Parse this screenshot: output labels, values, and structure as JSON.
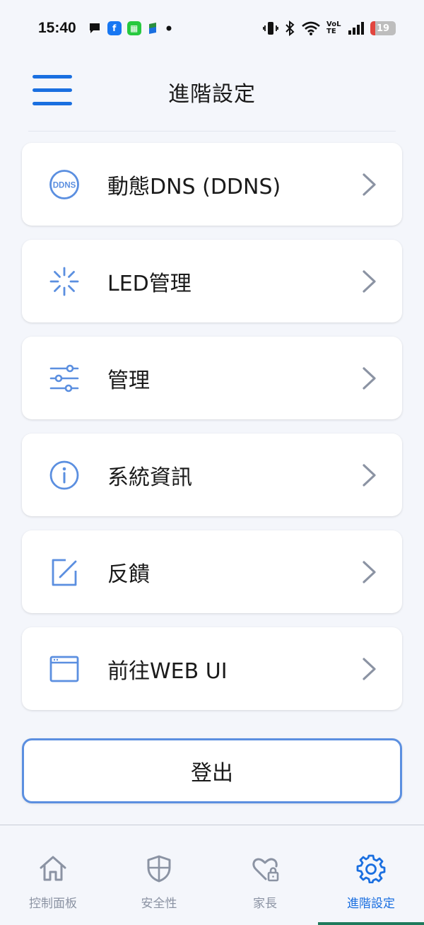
{
  "status_bar": {
    "time": "15:40",
    "battery_level": "19",
    "battery_fraction": 0.19,
    "network": "VoLTE",
    "icons": [
      "chat-icon",
      "facebook-icon",
      "app-icon",
      "app-icon",
      "dot-icon",
      "vibrate-icon",
      "bluetooth-icon",
      "wifi-icon",
      "signal-icon"
    ]
  },
  "header": {
    "title": "進階設定"
  },
  "menu": {
    "items": [
      {
        "label": "動態DNS (DDNS)",
        "icon": "ddns-icon",
        "icon_text": "DDNS"
      },
      {
        "label": "LED管理",
        "icon": "led-icon"
      },
      {
        "label": "管理",
        "icon": "sliders-icon"
      },
      {
        "label": "系統資訊",
        "icon": "info-icon"
      },
      {
        "label": "反饋",
        "icon": "edit-icon"
      },
      {
        "label": "前往WEB UI",
        "icon": "browser-window-icon"
      }
    ]
  },
  "logout": {
    "label": "登出"
  },
  "bottom_nav": {
    "items": [
      {
        "label": "控制面板",
        "icon": "home-icon",
        "active": false
      },
      {
        "label": "安全性",
        "icon": "shield-icon",
        "active": false
      },
      {
        "label": "家長",
        "icon": "heart-lock-icon",
        "active": false
      },
      {
        "label": "進階設定",
        "icon": "gear-icon",
        "active": true
      }
    ]
  },
  "colors": {
    "accent": "#1a6fe0",
    "icon_blue": "#5b8fe0",
    "chevron": "#8b93a3",
    "background": "#f4f6fb",
    "battery_low": "#e2463f"
  }
}
